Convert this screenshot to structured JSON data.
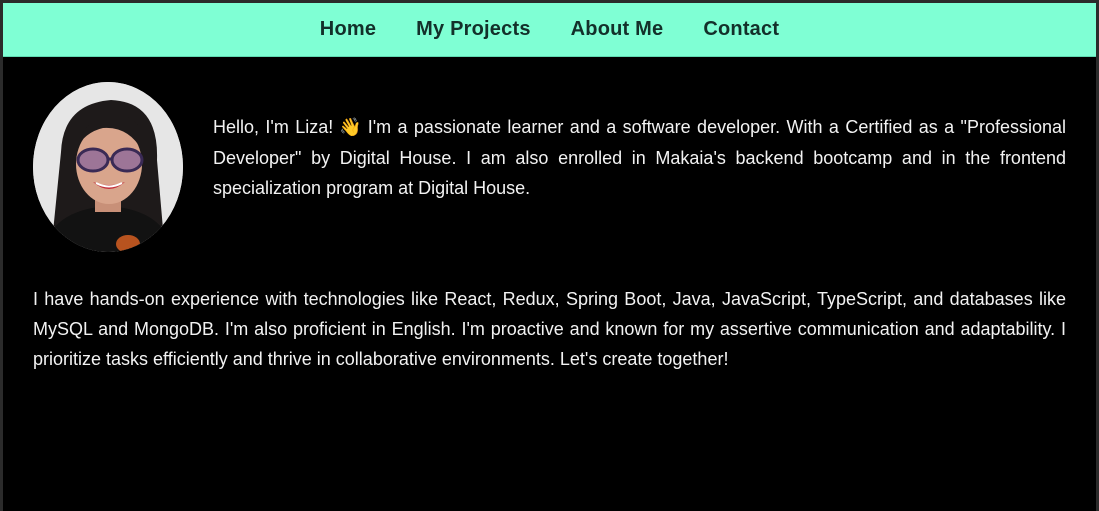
{
  "nav": {
    "items": [
      {
        "label": "Home"
      },
      {
        "label": "My Projects"
      },
      {
        "label": "About Me"
      },
      {
        "label": "Contact"
      }
    ]
  },
  "colors": {
    "nav_background": "#7fffd4",
    "nav_text": "#13302a",
    "page_background": "#000000",
    "body_text": "#f2f2f2"
  },
  "about": {
    "avatar_icon": "profile-photo",
    "intro_before": "Hello, I'm Liza!",
    "wave_emoji": "👋",
    "intro_after": "I'm a passionate learner and a software developer. With a Certified as a \"Professional Developer\" by Digital House. I am also enrolled in Makaia's backend bootcamp and in the frontend specialization program at Digital House.",
    "bio": "I have hands-on experience with technologies like React, Redux, Spring Boot, Java, JavaScript, TypeScript, and databases like MySQL and MongoDB. I'm also proficient in English. I'm proactive and known for my assertive communication and adaptability. I prioritize tasks efficiently and thrive in collaborative environments. Let's create together!"
  }
}
